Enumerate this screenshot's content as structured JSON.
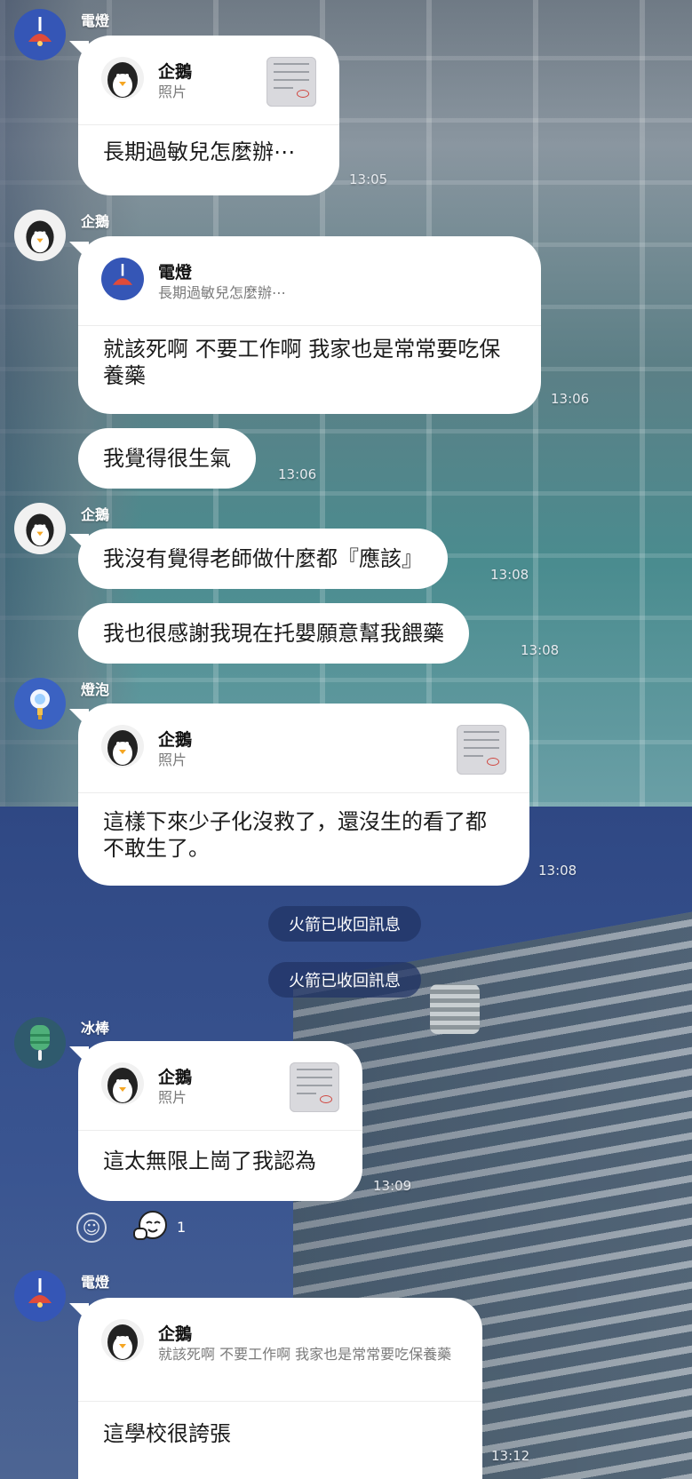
{
  "chat": {
    "msg1": {
      "sender": "電燈",
      "quote_name": "企鵝",
      "quote_sub": "照片",
      "text": "長期過敏兒怎麼辦⋯",
      "time": "13:05"
    },
    "msg2": {
      "sender": "企鵝",
      "quote_name": "電燈",
      "quote_sub": "長期過敏兒怎麼辦⋯",
      "text": "就該死啊 不要工作啊 我家也是常常要吃保養藥",
      "time": "13:06"
    },
    "msg3": {
      "text": "我覺得很生氣",
      "time": "13:06"
    },
    "msg4": {
      "sender": "企鵝",
      "text": "我沒有覺得老師做什麼都『應該』",
      "time": "13:08"
    },
    "msg5": {
      "text": "我也很感謝我現在托嬰願意幫我餵藥",
      "time": "13:08"
    },
    "msg6": {
      "sender": "燈泡",
      "quote_name": "企鵝",
      "quote_sub": "照片",
      "text": "這樣下來少子化沒救了，還沒生的看了都不敢生了。",
      "time": "13:08"
    },
    "system1": "火箭已收回訊息",
    "system2": "火箭已收回訊息",
    "msg7": {
      "sender": "冰棒",
      "quote_name": "企鵝",
      "quote_sub": "照片",
      "text": "這太無限上崗了我認為",
      "time": "13:09"
    },
    "reaction_count": "1",
    "msg8": {
      "sender": "電燈",
      "quote_name": "企鵝",
      "quote_sub": "就該死啊 不要工作啊 我家也是常常要吃保養藥",
      "text": "這學校很誇張",
      "time": "13:12"
    }
  },
  "icons": {
    "lamp_avatar": "ceiling-lamp-icon",
    "penguin_avatar": "penguin-icon",
    "bulb_avatar": "light-bulb-icon",
    "popsicle_avatar": "popsicle-icon",
    "photo_thumb": "photo-thumbnail",
    "add_reaction": "smile-icon",
    "reaction_sticker": "sticker-reaction-icon"
  },
  "colors": {
    "bubble": "#ffffff",
    "system_pill": "#223466"
  }
}
